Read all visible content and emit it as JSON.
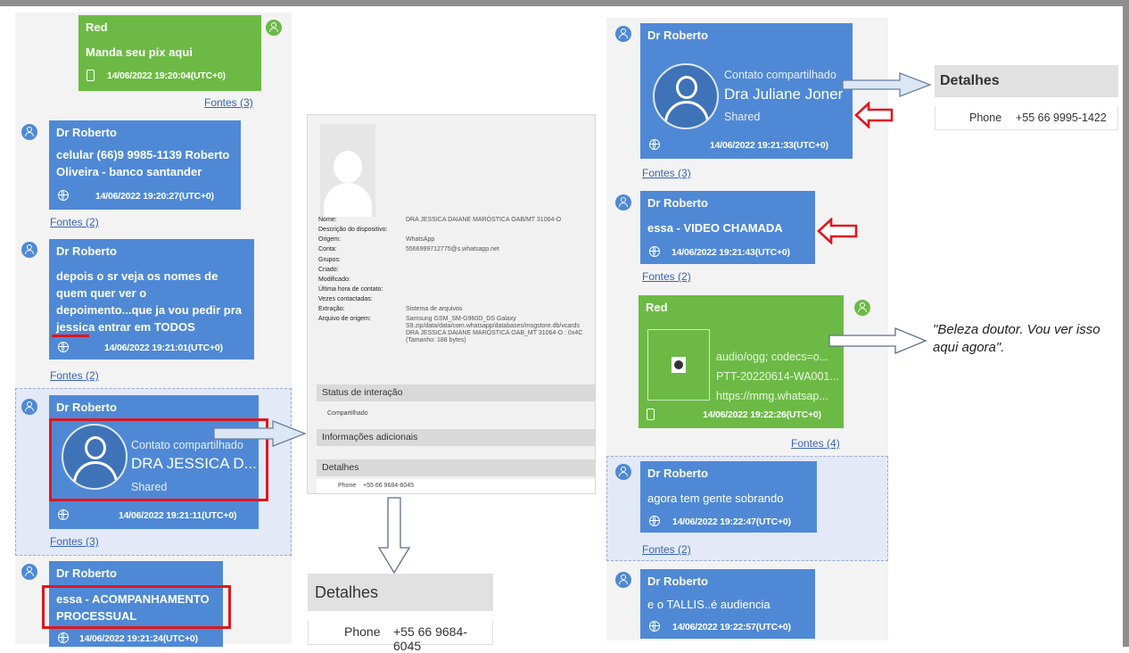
{
  "left": {
    "m1": {
      "name": "Red",
      "text": "Manda seu pix aqui",
      "time": "14/06/2022 19:20:04(UTC+0)",
      "fontes": "Fontes (3)"
    },
    "m2": {
      "name": "Dr Roberto",
      "line1": "celular (66)9 9985-1139 Roberto",
      "line2": "Oliveira - banco santander",
      "time": "14/06/2022 19:20:27(UTC+0)",
      "fontes": "Fontes (2)"
    },
    "m3": {
      "name": "Dr Roberto",
      "line1": "depois o sr veja os nomes de",
      "line2": "quem quer ver o",
      "line3": "depoimento...que ja vou pedir pra",
      "line4": "jessica entrar em TODOS",
      "time": "14/06/2022 19:21:01(UTC+0)",
      "fontes": "Fontes (2)"
    },
    "m4": {
      "name": "Dr Roberto",
      "contact_title": "Contato compartilhado",
      "contact_name": "DRA JESSICA D...",
      "shared": "Shared",
      "time": "14/06/2022 19:21:11(UTC+0)",
      "fontes": "Fontes (3)"
    },
    "m5": {
      "name": "Dr Roberto",
      "line1": "essa - ACOMPANHAMENTO",
      "line2": "PROCESSUAL",
      "time": "14/06/2022 19:21:24(UTC+0)"
    }
  },
  "doc": {
    "labels": [
      "Nome:",
      "Descrição do dispositivo:",
      "Origem:",
      "Conta:",
      "Grupos:",
      "Criado:",
      "Modificado:",
      "Última hora de contato:",
      "Vezes contactadas:",
      "Extração:",
      "Arquivo de origem:"
    ],
    "name_value": "DRA JESSICA DAIANE MARÓSTICA OAB/MT 31064-O",
    "origin_value": "WhatsApp",
    "account_value": "5566999712775@s.whatsapp.net",
    "extraction_value": "Sistema de arquivos",
    "source_file_value": "Samsung GSM_SM-G960D_DS Galaxy S9.zip/data/data/com.whatsapp/databases/msgstore.db/vcards DRA JESSICA DAIANE MARÓSTICA OAB_MT 31064-O : 0x4C (Tamanho: 188 bytes)",
    "section_status": "Status de interação",
    "status_value": "Compartilhado",
    "section_info": "Informações adicionais",
    "section_details": "Detalhes",
    "phone_label": "Phone",
    "phone_value": "+55 66 9684-6045"
  },
  "details_bottom": {
    "title": "Detalhes",
    "phone_label": "Phone",
    "phone_value": "+55 66 9684-6045"
  },
  "right": {
    "r1": {
      "name": "Dr Roberto",
      "contact_title": "Contato compartilhado",
      "contact_name": "Dra Juliane Joner",
      "shared": "Shared",
      "time": "14/06/2022 19:21:33(UTC+0)",
      "fontes": "Fontes (3)"
    },
    "r2": {
      "name": "Dr Roberto",
      "text": "essa - VIDEO CHAMADA",
      "time": "14/06/2022 19:21:43(UTC+0)",
      "fontes": "Fontes (2)"
    },
    "r3": {
      "name": "Red",
      "line1": "audio/ogg; codecs=o...",
      "line2": "PTT-20220614-WA001...",
      "line3": "https://mmg.whatsap...",
      "time": "14/06/2022 19:22:26(UTC+0)",
      "fontes": "Fontes (4)"
    },
    "r4": {
      "name": "Dr Roberto",
      "text": "agora tem gente sobrando",
      "time": "14/06/2022 19:22:47(UTC+0)",
      "fontes": "Fontes (2)"
    },
    "r5": {
      "name": "Dr Roberto",
      "text": "e o TALLIS..é audiencia",
      "time": "14/06/2022 19:22:57(UTC+0)"
    }
  },
  "details_right": {
    "title": "Detalhes",
    "phone_label": "Phone",
    "phone_value": "+55 66 9995-1422"
  },
  "quote": "\"Beleza doutor. Vou ver isso aqui agora\".",
  "colors": {
    "bubble_blue": "#4f89d6",
    "bubble_green": "#6cba45",
    "highlight_red": "#e0161e",
    "link_blue": "#3a63b8"
  }
}
